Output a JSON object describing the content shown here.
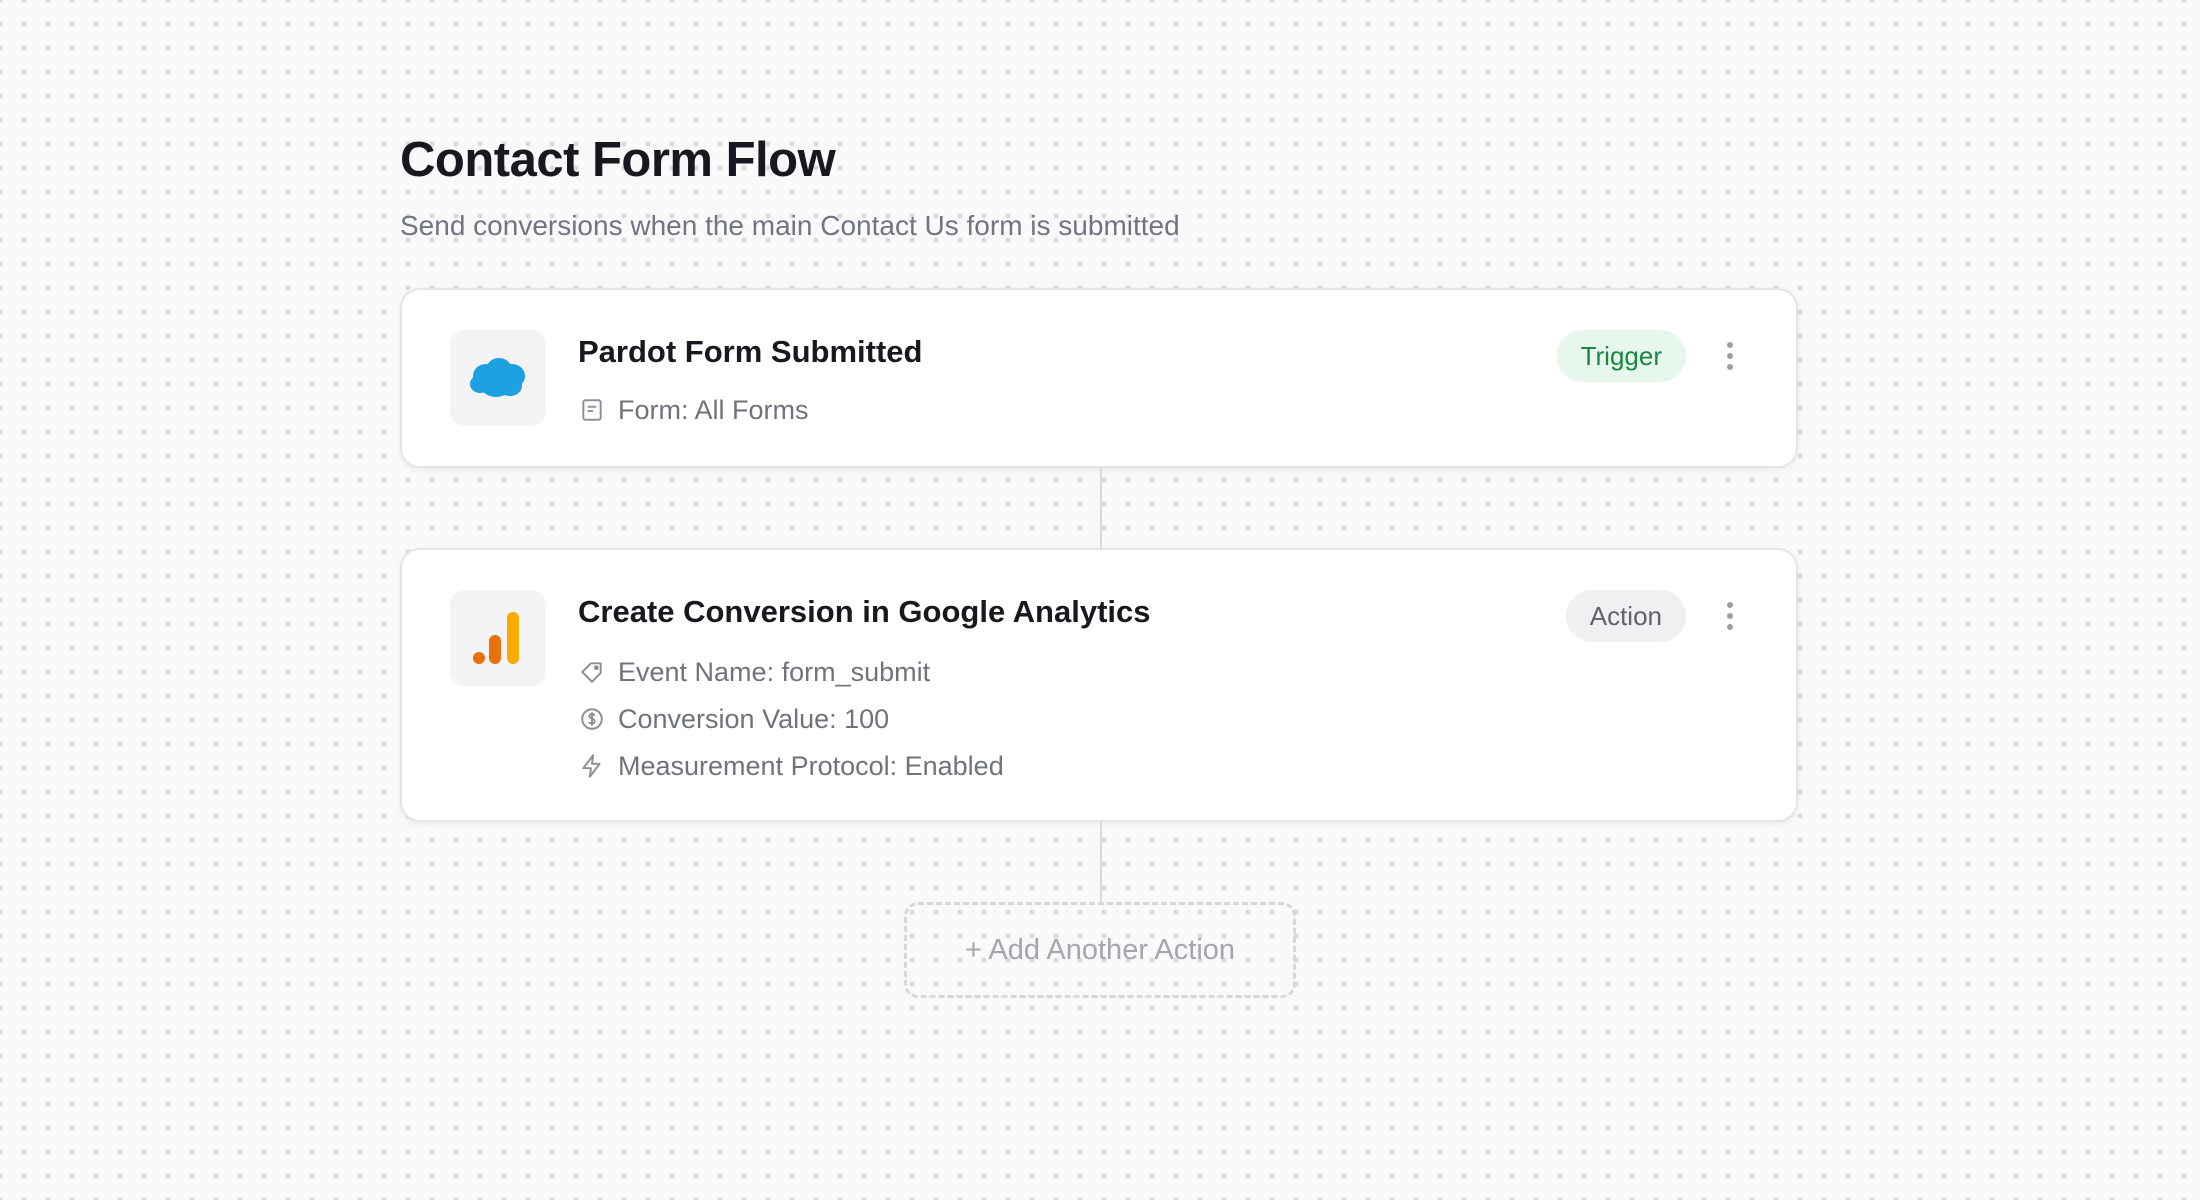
{
  "page": {
    "title": "Contact Form Flow",
    "subtitle": "Send conversions when the main Contact Us form is submitted"
  },
  "trigger": {
    "app_icon": "salesforce-cloud-icon",
    "title": "Pardot Form Submitted",
    "badge": "Trigger",
    "details": [
      {
        "icon": "form-document-icon",
        "text": "Form: All Forms"
      }
    ]
  },
  "action": {
    "app_icon": "google-analytics-icon",
    "title": "Create Conversion in Google Analytics",
    "badge": "Action",
    "details": [
      {
        "icon": "tag-icon",
        "text": "Event Name: form_submit"
      },
      {
        "icon": "dollar-circle-icon",
        "text": "Conversion Value: 100"
      },
      {
        "icon": "lightning-bolt-icon",
        "text": "Measurement Protocol: Enabled"
      }
    ]
  },
  "add_action": {
    "label": "+ Add Another Action"
  },
  "colors": {
    "background": "#f9f9fa",
    "trigger_badge_bg": "#e7f7ed",
    "trigger_badge_text": "#19873f",
    "action_badge_bg": "#f0f0f2",
    "salesforce_blue": "#1ea1e0",
    "ga_orange_dark": "#e8710a",
    "ga_orange_light": "#f9ab00"
  }
}
